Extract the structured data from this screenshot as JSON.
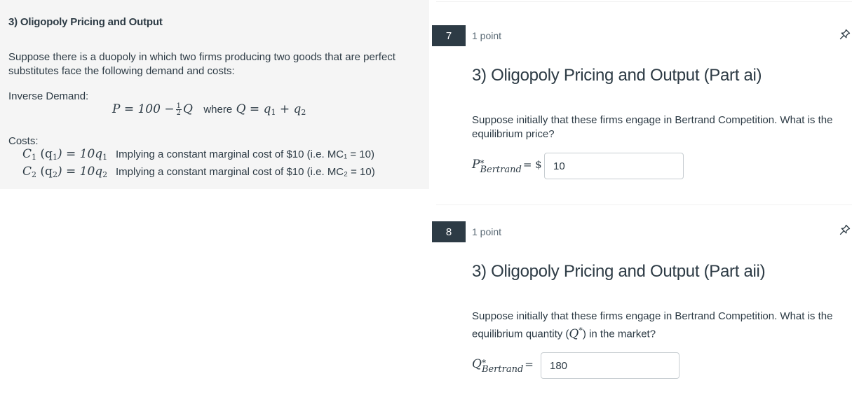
{
  "stimulus": {
    "title": "3) Oligopoly Pricing and Output",
    "intro": "Suppose there is a duopoly in which two firms producing two goods that are perfect substitutes face the following demand and costs:",
    "inverse_demand_label": "Inverse Demand:",
    "demand_equation": {
      "lhs": "P = 100 −",
      "frac_num": "1",
      "frac_den": "2",
      "var": "Q",
      "where_text": "where",
      "rhs": "Q = q",
      "rhs_sub1": "1",
      "plus": " + q",
      "rhs_sub2": "2"
    },
    "costs_label": "Costs:",
    "cost_rows": [
      {
        "c": "C",
        "sub": "1",
        "arg": " (q",
        "argsub": "1",
        "eq": ") = 10q",
        "eqsub": "1",
        "note": "Implying a constant marginal cost of $10 (i.e. MC₁ = 10)"
      },
      {
        "c": "C",
        "sub": "2",
        "arg": " (q",
        "argsub": "2",
        "eq": ") = 10q",
        "eqsub": "2",
        "note": "Implying a constant marginal cost of $10 (i.e. MC₂ = 10)"
      }
    ]
  },
  "questions": [
    {
      "number": "7",
      "points": "1 point",
      "title": "3) Oligopoly Pricing and Output (Part ai)",
      "text": "Suppose initially that these firms engage in Bertrand Competition. What is the equilibrium price?",
      "answer_var": "P",
      "answer_sup": "*",
      "answer_sub": "Bertrand",
      "answer_eq": "= $",
      "answer_value": "10"
    },
    {
      "number": "8",
      "points": "1 point",
      "title": "3) Oligopoly Pricing and Output (Part aii)",
      "text_before": "Suppose initially that these firms engage in Bertrand Competition. What is the equilibrium quantity (",
      "text_var": "Q",
      "text_sup": "*",
      "text_after": ") in the market?",
      "answer_var": "Q",
      "answer_sup": "*",
      "answer_sub": "Bertrand",
      "answer_eq": "=",
      "answer_value": "180"
    }
  ],
  "icons": {
    "pin": "pin-icon"
  },
  "colors": {
    "text": "#2d3b45",
    "question_number_bg": "#2d3b45",
    "stimulus_bg": "#f5f5f5",
    "input_border": "#c7cdd1"
  }
}
